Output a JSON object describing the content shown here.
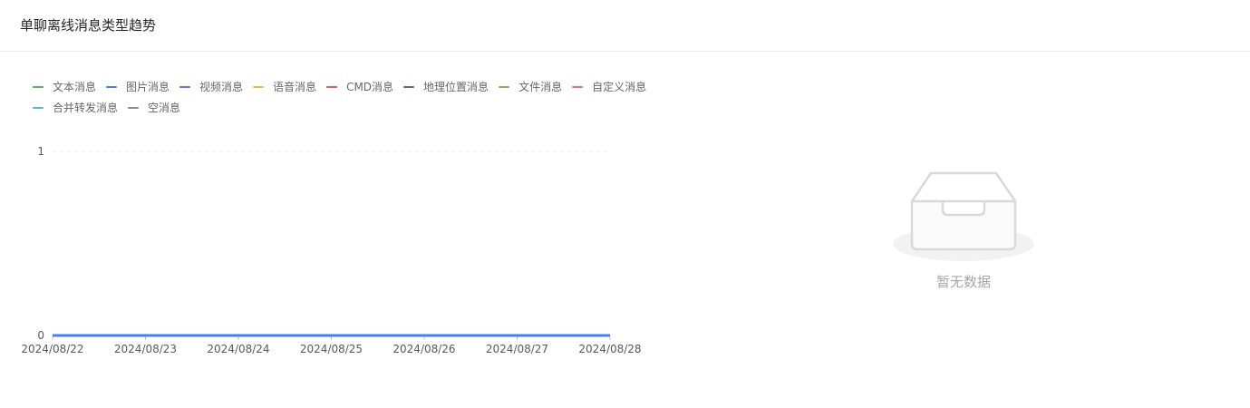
{
  "header": {
    "title": "单聊离线消息类型趋势"
  },
  "legend": {
    "row1": [
      {
        "label": "文本消息",
        "color": "#52b05a"
      },
      {
        "label": "图片消息",
        "color": "#4a7ee8"
      },
      {
        "label": "视频消息",
        "color": "#7b6be6"
      },
      {
        "label": "语音消息",
        "color": "#f0b93a"
      },
      {
        "label": "CMD消息",
        "color": "#e85a4a"
      },
      {
        "label": "地理位置消息",
        "color": "#5a6b8c"
      },
      {
        "label": "文件消息",
        "color": "#9aa85a"
      },
      {
        "label": "自定义消息",
        "color": "#ea6a8a"
      }
    ],
    "row2": [
      {
        "label": "合并转发消息",
        "color": "#4ac0c8"
      },
      {
        "label": "空消息",
        "color": "#8c8c8c"
      }
    ]
  },
  "empty_state": {
    "text": "暂无数据",
    "icon": "empty-inbox-icon"
  },
  "chart_data": {
    "type": "line",
    "x": [
      "2024/08/22",
      "2024/08/23",
      "2024/08/24",
      "2024/08/25",
      "2024/08/26",
      "2024/08/27",
      "2024/08/28"
    ],
    "series": [
      {
        "name": "文本消息",
        "color": "#52b05a",
        "values": [
          0,
          0,
          0,
          0,
          0,
          0,
          0
        ]
      },
      {
        "name": "图片消息",
        "color": "#4a7ee8",
        "values": [
          0,
          0,
          0,
          0,
          0,
          0,
          0
        ]
      },
      {
        "name": "视频消息",
        "color": "#7b6be6",
        "values": [
          0,
          0,
          0,
          0,
          0,
          0,
          0
        ]
      },
      {
        "name": "语音消息",
        "color": "#f0b93a",
        "values": [
          0,
          0,
          0,
          0,
          0,
          0,
          0
        ]
      },
      {
        "name": "CMD消息",
        "color": "#e85a4a",
        "values": [
          0,
          0,
          0,
          0,
          0,
          0,
          0
        ]
      },
      {
        "name": "地理位置消息",
        "color": "#5a6b8c",
        "values": [
          0,
          0,
          0,
          0,
          0,
          0,
          0
        ]
      },
      {
        "name": "文件消息",
        "color": "#9aa85a",
        "values": [
          0,
          0,
          0,
          0,
          0,
          0,
          0
        ]
      },
      {
        "name": "自定义消息",
        "color": "#ea6a8a",
        "values": [
          0,
          0,
          0,
          0,
          0,
          0,
          0
        ]
      },
      {
        "name": "合并转发消息",
        "color": "#4ac0c8",
        "values": [
          0,
          0,
          0,
          0,
          0,
          0,
          0
        ]
      },
      {
        "name": "空消息",
        "color": "#8c8c8c",
        "values": [
          0,
          0,
          0,
          0,
          0,
          0,
          0
        ]
      }
    ],
    "ylim": [
      0,
      1
    ],
    "yticks": [
      "0",
      "1"
    ],
    "grid": true,
    "legend_position": "top-left"
  }
}
